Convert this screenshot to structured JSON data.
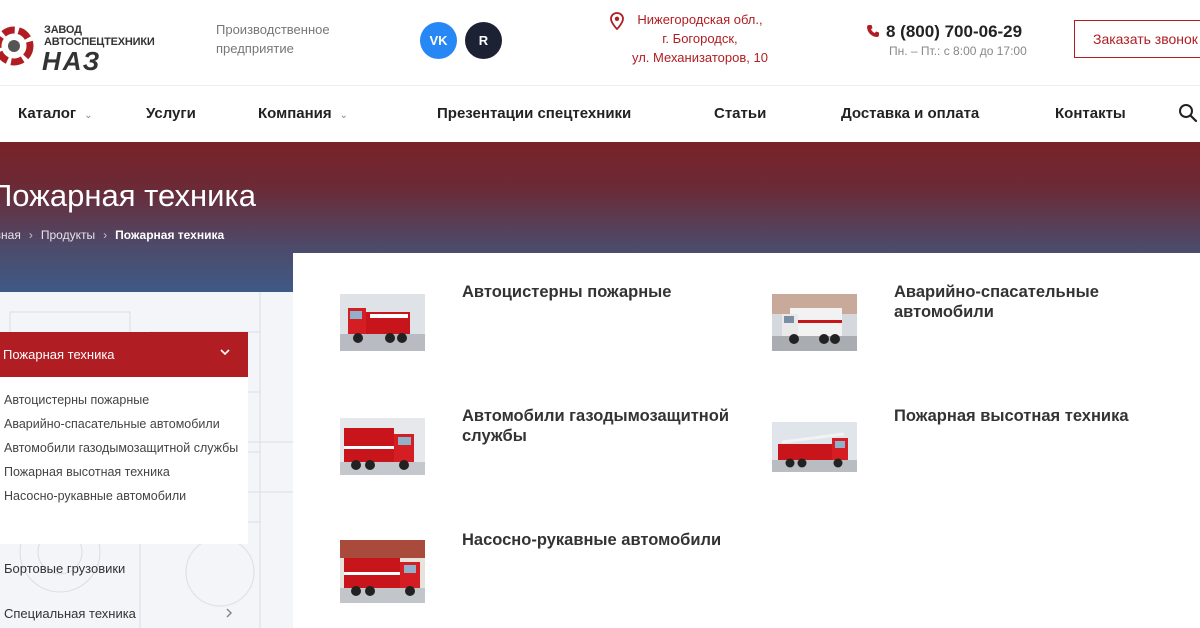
{
  "header": {
    "logo_small": "ЗАВОД АВТОСПЕЦТЕХНИКИ",
    "logo_big": "НАЗ",
    "tagline": "Производственное предприятие",
    "social": [
      {
        "label": "VK",
        "icon": "vk-icon",
        "color": "#2787f5"
      },
      {
        "label": "R",
        "icon": "rutube-icon",
        "color": "#1c2233"
      }
    ],
    "address_lines": [
      "Нижегородская обл.,",
      "г. Богородск,",
      "ул. Механизаторов, 10"
    ],
    "phone": "8 (800) 700-06-29",
    "hours": "Пн. – Пт.: с 8:00 до 17:00",
    "callback_label": "Заказать звонок"
  },
  "nav": {
    "items": [
      {
        "label": "Каталог",
        "has_dropdown": true
      },
      {
        "label": "Услуги",
        "has_dropdown": false
      },
      {
        "label": "Компания",
        "has_dropdown": true
      },
      {
        "label": "Презентации спецтехники",
        "has_dropdown": false
      },
      {
        "label": "Статьи",
        "has_dropdown": false
      },
      {
        "label": "Доставка и оплата",
        "has_dropdown": false
      },
      {
        "label": "Контакты",
        "has_dropdown": false
      }
    ],
    "dropdown_glyph": "⌄",
    "search_icon": "search-icon"
  },
  "hero": {
    "title": "Пожарная техника",
    "breadcrumbs": [
      "авная",
      "Продукты",
      "Пожарная техника"
    ],
    "separator": "›"
  },
  "sidebar": {
    "active": "Пожарная техника",
    "subitems": [
      "Автоцистерны пожарные",
      "Аварийно-спасательные автомобили",
      "Автомобили газодымозащитной службы",
      "Пожарная высотная техника",
      "Насосно-рукавные автомобили"
    ],
    "items": [
      "Бортовые грузовики",
      "Специальная техника"
    ]
  },
  "products": [
    {
      "title": "Автоцистерны пожарные"
    },
    {
      "title": "Аварийно-спасательные автомобили"
    },
    {
      "title": "Автомобили газодымозащитной службы"
    },
    {
      "title": "Пожарная высотная техника"
    },
    {
      "title": "Насосно-рукавные автомобили"
    }
  ],
  "colors": {
    "brand_red": "#b01e23",
    "hero_top": "#7a2228",
    "hero_bottom": "#3f5a86"
  }
}
